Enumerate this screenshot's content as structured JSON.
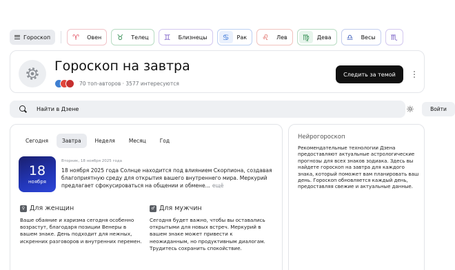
{
  "nav": {
    "menu_label": "Гороскоп",
    "signs": [
      {
        "symbol": "♈",
        "label": "Овен",
        "color": "#e0495a",
        "border": "#f1c3c8",
        "bg": "#ffffff"
      },
      {
        "symbol": "♉",
        "label": "Телец",
        "color": "#2e8b4e",
        "border": "#b8dcc3",
        "bg": "#ffffff"
      },
      {
        "symbol": "♊",
        "label": "Близнецы",
        "color": "#7a5cc7",
        "border": "#d3c8ef",
        "bg": "#ffffff"
      },
      {
        "symbol": "♋",
        "label": "Рак",
        "color": "#2f6fd6",
        "border": "#bcd0f2",
        "bg": "#eaf1fd"
      },
      {
        "symbol": "♌",
        "label": "Лев",
        "color": "#d9473e",
        "border": "#f1c2bd",
        "bg": "#ffffff"
      },
      {
        "symbol": "♍",
        "label": "Дева",
        "color": "#2e8b4e",
        "border": "#b8dcc3",
        "bg": "#e7f5ec"
      },
      {
        "symbol": "♎",
        "label": "Весы",
        "color": "#3356b8",
        "border": "#c3cdee",
        "bg": "#ffffff"
      },
      {
        "symbol": "♏",
        "label": "",
        "color": "#6b4fbf",
        "border": "#d3c8ef",
        "bg": "#ffffff"
      }
    ]
  },
  "channel": {
    "title": "Гороскоп на завтра",
    "meta": "70 топ-авторов · 3577 интересуются",
    "follow_label": "Следить за темой",
    "logo_icon": "gear-icon"
  },
  "search": {
    "placeholder": "Найти в Дзене"
  },
  "header_actions": {
    "theme_icon": "sun-icon",
    "login_label": "Войти"
  },
  "tabs": [
    {
      "label": "Сегодня",
      "active": false
    },
    {
      "label": "Завтра",
      "active": true
    },
    {
      "label": "Неделя",
      "active": false
    },
    {
      "label": "Месяц",
      "active": false
    },
    {
      "label": "Год",
      "active": false
    }
  ],
  "post": {
    "day_number": "18",
    "day_month": "ноября",
    "date_line": "Вторник, 18 ноября 2025 года",
    "text": "18 ноября 2025 года Солнце находится под влиянием Скорпиона, создавая благоприятную среду для открытия вашего внутреннего мира. Меркурий предлагает сфокусироваться на общении и обмене...",
    "more_label": "ещё"
  },
  "women": {
    "title": "Для женщин",
    "text": "Ваше обаяние и харизма сегодня особенно возрастут, благодаря позиции Венеры в вашем знаке. День подходит для нежных, искренних разговоров и внутренних перемен."
  },
  "men": {
    "title": "Для мужчин",
    "text": "Сегодня будет важно, чтобы вы оставались открытыми для новых встреч. Меркурий в вашем знаке может привести к неожиданным, но продуктивным диалогам. Трудитесь сохранить спокойствие."
  },
  "side": {
    "title": "Нейрогороскоп",
    "text": "Рекомендательные технологии Дзена предоставляют актуальные астрологические прогнозы для всех знаков зодиака. Здесь вы найдете гороскоп на завтра для каждого знака, который поможет вам планировать ваш день. Гороскоп обновляется каждый день, предоставляя свежие и актуальные данные."
  }
}
